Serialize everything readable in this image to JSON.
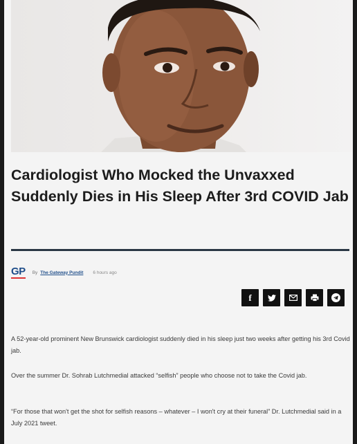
{
  "article": {
    "headline": "Cardiologist Who Mocked the Unvaxxed Suddenly Dies in His Sleep After 3rd COVID Jab",
    "byline": {
      "logo": "GP",
      "by": "By",
      "author": "The Gateway Pundit",
      "time": "6 hours ago"
    },
    "share": [
      {
        "icon": "facebook-icon",
        "glyph": "f"
      },
      {
        "icon": "twitter-icon",
        "glyph": "t"
      },
      {
        "icon": "email-icon",
        "glyph": "mail"
      },
      {
        "icon": "print-icon",
        "glyph": "print"
      },
      {
        "icon": "telegram-icon",
        "glyph": "telegram"
      }
    ],
    "paragraphs": [
      "A 52-year-old prominent New Brunswick cardiologist suddenly died in his sleep just two weeks after getting his 3rd Covid jab.",
      "Over the summer Dr. Sohrab Lutchmedial attacked “selfish” people who choose not to take the Covid jab.",
      "“For those that won't get the shot for selfish reasons – whatever – I won't cry at their funeral” Dr. Lutchmedial said in a July 2021 tweet."
    ]
  },
  "colors": {
    "rule": "#2a3744",
    "logo_blue": "#1f4e8a",
    "share_bg": "#111111"
  }
}
